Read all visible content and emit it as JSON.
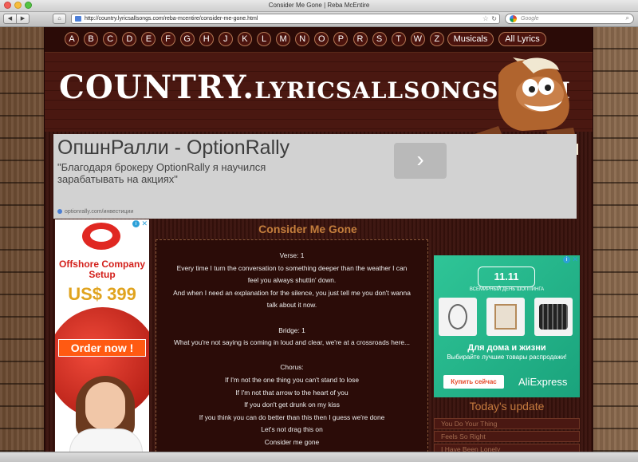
{
  "window": {
    "title": "Consider Me Gone | Reba McEntire"
  },
  "browser": {
    "url": "http://country.lyricsallsongs.com/reba-mcentire/consider-me-gone.html",
    "search_placeholder": "Google",
    "back_icon": "◀",
    "forward_icon": "▶",
    "home_icon": "⌂",
    "star_icon": "☆",
    "reload_icon": "↻",
    "search_icon": "⌕"
  },
  "nav": {
    "letters": [
      "A",
      "B",
      "C",
      "D",
      "E",
      "F",
      "G",
      "H",
      "J",
      "K",
      "L",
      "M",
      "N",
      "O",
      "P",
      "R",
      "S",
      "T",
      "W",
      "Z",
      "#"
    ],
    "musicals": "Musicals",
    "all_lyrics": "All Lyrics"
  },
  "site": {
    "logo_main": "COUNTRY.",
    "logo_domain": "LYRICSALLSONGS.COM"
  },
  "ad_banner": {
    "title": "ОпшнРалли - OptionRally",
    "description": "\"Благодаря брокеру OptionRally я научился зарабатывать на акциях\"",
    "source": "optionrally.com/инвестиции",
    "arrow": "›"
  },
  "left_ad": {
    "title": "Offshore Company Setup",
    "price": "US$ 399",
    "cta": "Order now !",
    "info": "i",
    "close": "✕"
  },
  "song": {
    "title": "Consider Me Gone",
    "lyrics": [
      "Verse: 1",
      "Every time I turn the conversation to something deeper than the weather I can",
      "feel you always shuttin' down.",
      "And when I need an explanation for the silence, you just tell me you don't wanna",
      "talk about it now.",
      "",
      "Bridge: 1",
      "What you're not saying is coming in loud and clear, we're at a crossroads here...",
      "",
      "Chorus:",
      "If I'm not the one thing you can't stand to lose",
      "If I'm not that arrow to the heart of you",
      "If you don't get drunk on my kiss",
      "If you think you can do better than this then I guess we're done",
      "Let's not drag this on",
      "Consider me gone"
    ]
  },
  "right_ad": {
    "badge": "11.11",
    "caption": "ВСЕМИРНЫЙ ДЕНЬ ШОППИНГА",
    "headline": "Для дома и жизни",
    "sub": "Выбирайте лучшие товары распродажи!",
    "button": "Купить сейчас",
    "brand": "AliExpress",
    "info": "i",
    "close": "✕"
  },
  "sidebar": {
    "heading": "Today's update",
    "items": [
      "You Do Your Thing",
      "Feels So Right",
      "I Have Been Lonely"
    ]
  }
}
